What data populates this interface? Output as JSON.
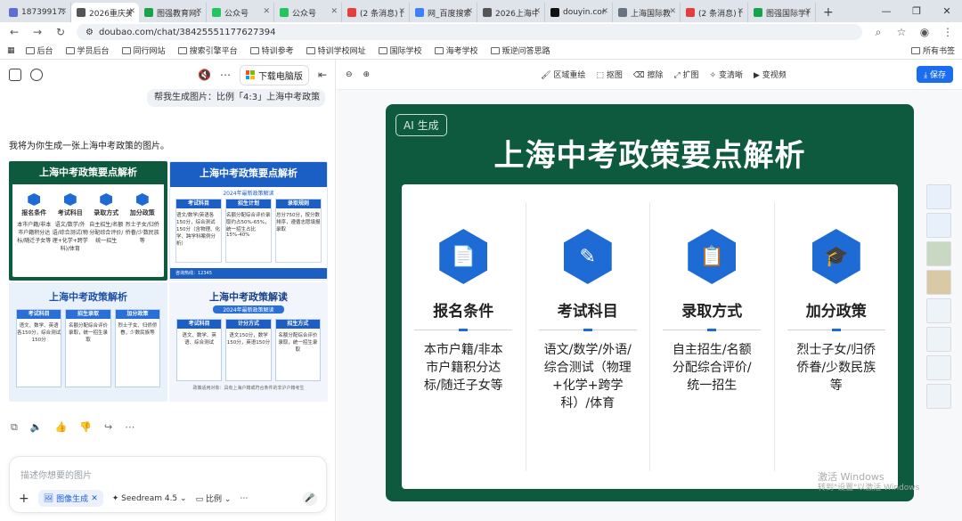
{
  "tabs": [
    {
      "label": "18739917226",
      "color": "#5b6fd6",
      "active": false
    },
    {
      "label": "2026重庆美术",
      "color": "#555",
      "active": true
    },
    {
      "label": "图强教育网站",
      "color": "#16a34a",
      "active": false
    },
    {
      "label": "公众号",
      "color": "#22c55e",
      "active": false
    },
    {
      "label": "公众号",
      "color": "#22c55e",
      "active": false
    },
    {
      "label": "(2 条消息) 图",
      "color": "#e53e3e",
      "active": false
    },
    {
      "label": "网_百度搜索",
      "color": "#3b82f6",
      "active": false
    },
    {
      "label": "2026上海中考",
      "color": "#555",
      "active": false
    },
    {
      "label": "douyin.com",
      "color": "#111",
      "active": false
    },
    {
      "label": "上海国际教",
      "color": "#6b7280",
      "active": false
    },
    {
      "label": "(2 条消息) 图",
      "color": "#e53e3e",
      "active": false
    },
    {
      "label": "图强国际学校",
      "color": "#16a34a",
      "active": false
    }
  ],
  "address": {
    "url": "doubao.com/chat/38425551177627394"
  },
  "bookmarks": [
    "后台",
    "学员后台",
    "同行网站",
    "搜索引擎平台",
    "特训参考",
    "特训学校网址",
    "国际学校",
    "海考学校",
    "叛逆问答思路"
  ],
  "bookmarks_all": "所有书签",
  "left": {
    "download_label": "下载电脑版",
    "user_message": "帮我生成图片：比例「4:3」上海中考政策",
    "intro": "我将为你生成一张上海中考政策的图片。",
    "thumb1": {
      "title": "上海中考政策要点解析",
      "items": [
        {
          "h": "报名条件",
          "b": "本市户籍/非本市户籍积分达标/随迁子女等"
        },
        {
          "h": "考试科目",
          "b": "语文/数学/外语/综合测试(物理+化学+跨学科)/体育"
        },
        {
          "h": "录取方式",
          "b": "自主招生/名额分配综合评价/统一招生"
        },
        {
          "h": "加分政策",
          "b": "烈士子女/归侨侨眷/少数民族等"
        }
      ]
    },
    "thumb2": {
      "title": "上海中考政策要点解析",
      "sub": "2024年最新政策解读",
      "cols": [
        {
          "h": "考试科目",
          "b": "语文/数学/英语各150分，综合测试150分（含物理、化学、跨学科案例分析）"
        },
        {
          "h": "招生计划",
          "b": "名额分配综合评价录取约占50%-65%，统一招生占比15%-40%"
        },
        {
          "h": "录取规则",
          "b": "总分750分，按分数排序，遵循志愿填报录取"
        }
      ],
      "footer": "咨询热线：12345"
    },
    "thumb3": {
      "title": "上海中考政策解析",
      "cols": [
        {
          "h": "考试科目",
          "b": "语文、数学、英语各150分，综合测试150分"
        },
        {
          "h": "招生录取",
          "b": "名额分配综合评价录取，统一招生录取"
        },
        {
          "h": "加分政策",
          "b": "烈士子女、归侨侨眷，少数民族等"
        }
      ]
    },
    "thumb4": {
      "title": "上海中考政策解读",
      "sub": "2024年最新政策解读",
      "cols": [
        {
          "h": "考试科目",
          "b": "语文、数学、英语、综合测试"
        },
        {
          "h": "计分方式",
          "b": "语文150分，数学150分，英语150分"
        },
        {
          "h": "招生方式",
          "b": "名额分配综合评价录取，统一招生录取"
        }
      ],
      "footer": "政策适用对象：具有上海户籍或符合条件的非沪户籍考生"
    },
    "input_placeholder": "描述你想要的图片",
    "chips": {
      "image": "图像生成",
      "model": "Seedream 4.5",
      "ratio": "比例"
    }
  },
  "right": {
    "tools": [
      "区域重绘",
      "抠图",
      "擦除",
      "扩图",
      "变清晰",
      "变视频"
    ],
    "save": "保存",
    "poster": {
      "ai_badge": "AI 生成",
      "title": "上海中考政策要点解析",
      "columns": [
        {
          "head": "报名条件",
          "body": "本市户籍/非本市户籍积分达标/随迁子女等"
        },
        {
          "head": "考试科目",
          "body": "语文/数学/外语/综合测试（物理+化学+跨学科）/体育"
        },
        {
          "head": "录取方式",
          "body": "自主招生/名额分配综合评价/统一招生"
        },
        {
          "head": "加分政策",
          "body": "烈士子女/归侨侨眷/少数民族等"
        }
      ]
    },
    "watermark": {
      "line1": "激活 Windows",
      "line2": "转到\"设置\"以激活 Windows"
    }
  }
}
